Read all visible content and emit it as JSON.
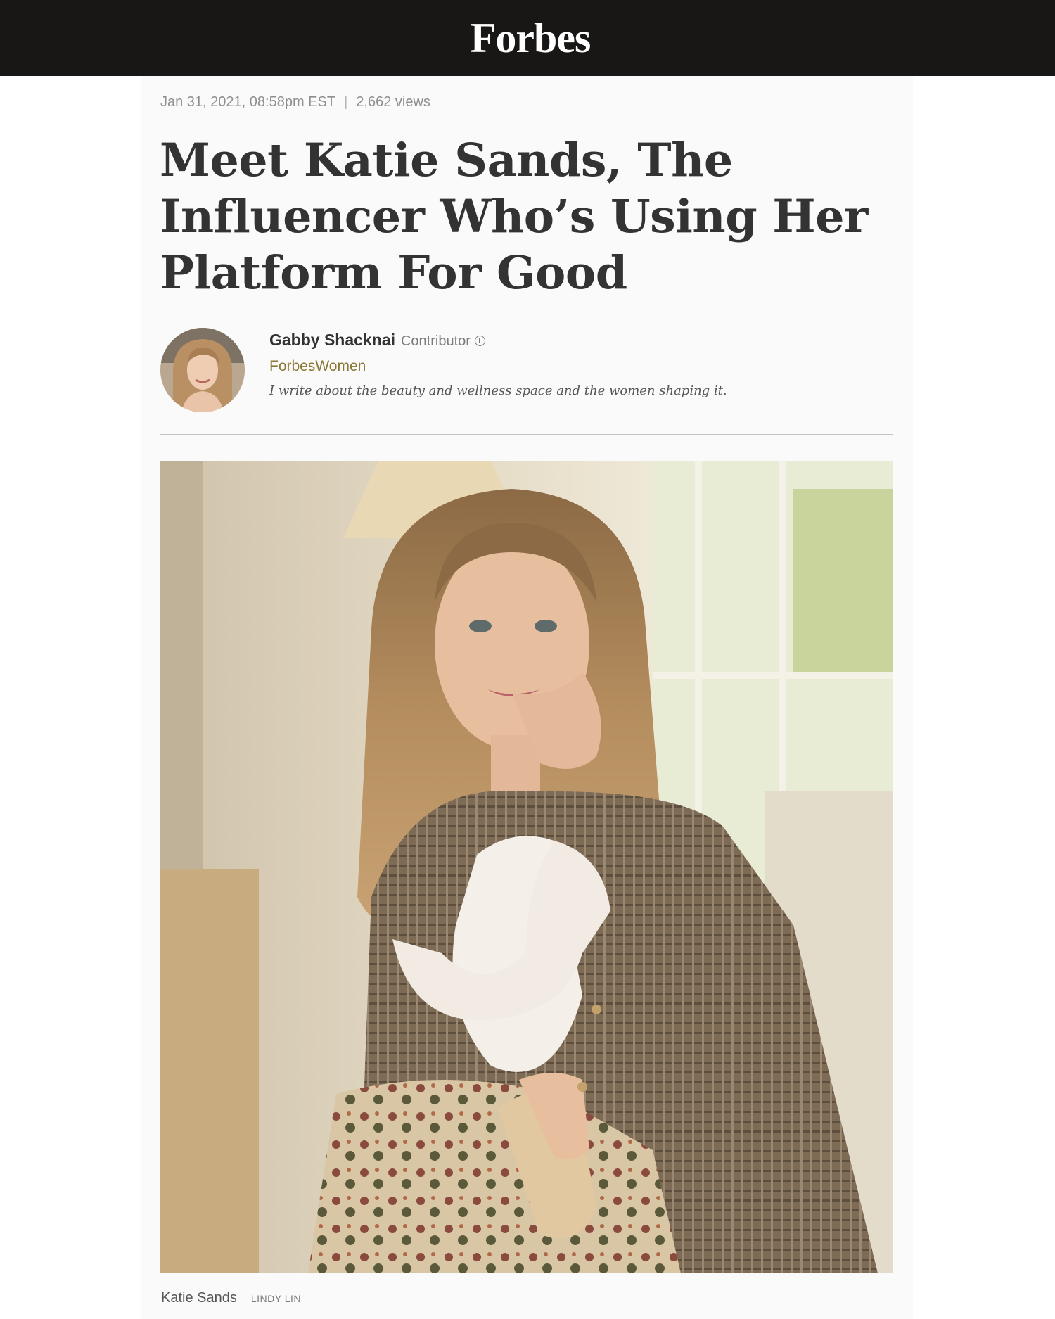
{
  "header": {
    "logo": "Forbes"
  },
  "article": {
    "date": "Jan 31, 2021, 08:58pm EST",
    "separator": "|",
    "views": "2,662 views",
    "headline": "Meet Katie Sands, The Influencer Who’s Using Her Platform For Good",
    "author": {
      "name": "Gabby Shacknai",
      "role": "Contributor",
      "channel": "ForbesWomen",
      "bio": "I write about the beauty and wellness space and the women shaping it.",
      "info_icon": "info-circle-icon"
    },
    "hero": {
      "caption": "Katie Sands",
      "credit": "LINDY LIN"
    }
  },
  "colors": {
    "topbar": "#181716",
    "channel": "#8a7733",
    "headline": "#333333"
  }
}
